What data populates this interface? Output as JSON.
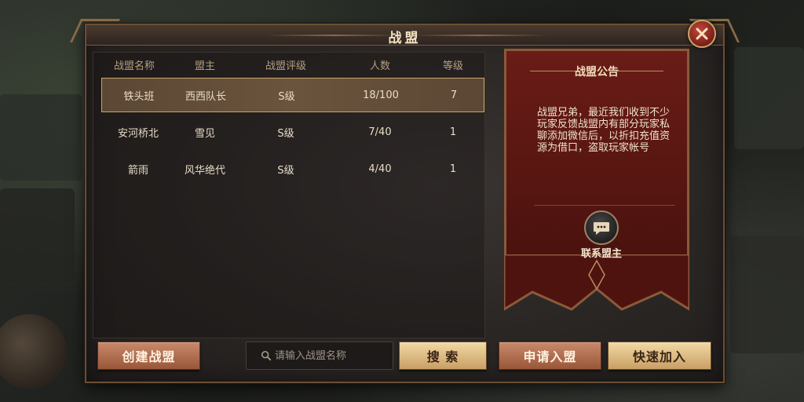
{
  "window": {
    "title": "战盟"
  },
  "list": {
    "headers": [
      "战盟名称",
      "盟主",
      "战盟评级",
      "人数",
      "等级"
    ],
    "rows": [
      {
        "name": "铁头班",
        "leader": "西西队长",
        "grade": "S级",
        "members": "18/100",
        "level": "7"
      },
      {
        "name": "安河桥北",
        "leader": "雪见",
        "grade": "S级",
        "members": "7/40",
        "level": "1"
      },
      {
        "name": "箭雨",
        "leader": "风华绝代",
        "grade": "S级",
        "members": "4/40",
        "level": "1"
      }
    ],
    "selected_row": 0
  },
  "notice": {
    "title": "战盟公告",
    "text": "战盟兄弟，最近我们收到不少玩家反馈战盟内有部分玩家私聊添加微信后，以折扣充值资源为借口，盗取玩家帐号",
    "contact_label": "联系盟主"
  },
  "buttons": {
    "create": "创建战盟",
    "search": "搜 索",
    "apply": "申请入盟",
    "quick_join": "快速加入"
  },
  "search": {
    "placeholder": "请输入战盟名称"
  },
  "colors": {
    "accent_red": "#6a1c17",
    "gold": "#c99f63",
    "selected": "#6b543d"
  }
}
